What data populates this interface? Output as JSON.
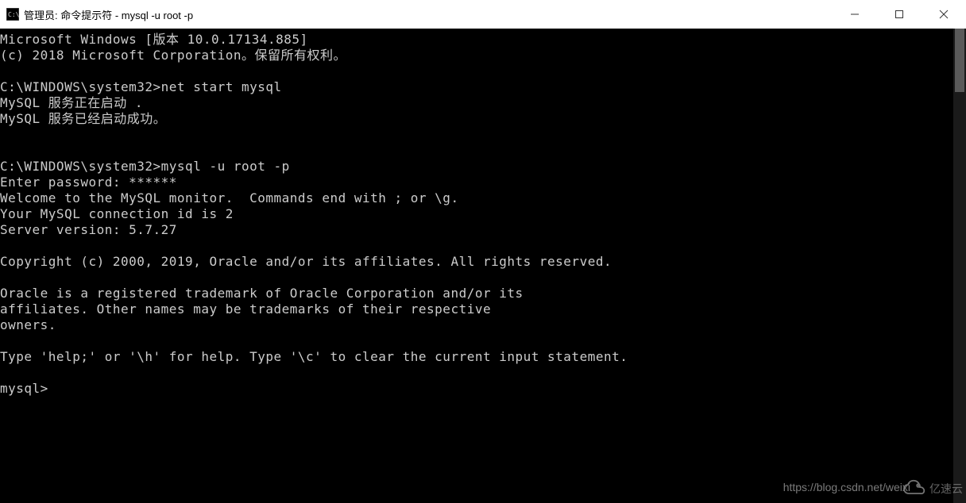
{
  "titlebar": {
    "title": "管理员: 命令提示符 - mysql  -u root -p"
  },
  "terminal": {
    "lines": [
      "Microsoft Windows [版本 10.0.17134.885]",
      "(c) 2018 Microsoft Corporation。保留所有权利。",
      "",
      "C:\\WINDOWS\\system32>net start mysql",
      "MySQL 服务正在启动 .",
      "MySQL 服务已经启动成功。",
      "",
      "",
      "C:\\WINDOWS\\system32>mysql -u root -p",
      "Enter password: ******",
      "Welcome to the MySQL monitor.  Commands end with ; or \\g.",
      "Your MySQL connection id is 2",
      "Server version: 5.7.27",
      "",
      "Copyright (c) 2000, 2019, Oracle and/or its affiliates. All rights reserved.",
      "",
      "Oracle is a registered trademark of Oracle Corporation and/or its",
      "affiliates. Other names may be trademarks of their respective",
      "owners.",
      "",
      "Type 'help;' or '\\h' for help. Type '\\c' to clear the current input statement.",
      "",
      "mysql>"
    ]
  },
  "watermark": {
    "url": "https://blog.csdn.net/weixi",
    "logo_text": "亿速云"
  }
}
